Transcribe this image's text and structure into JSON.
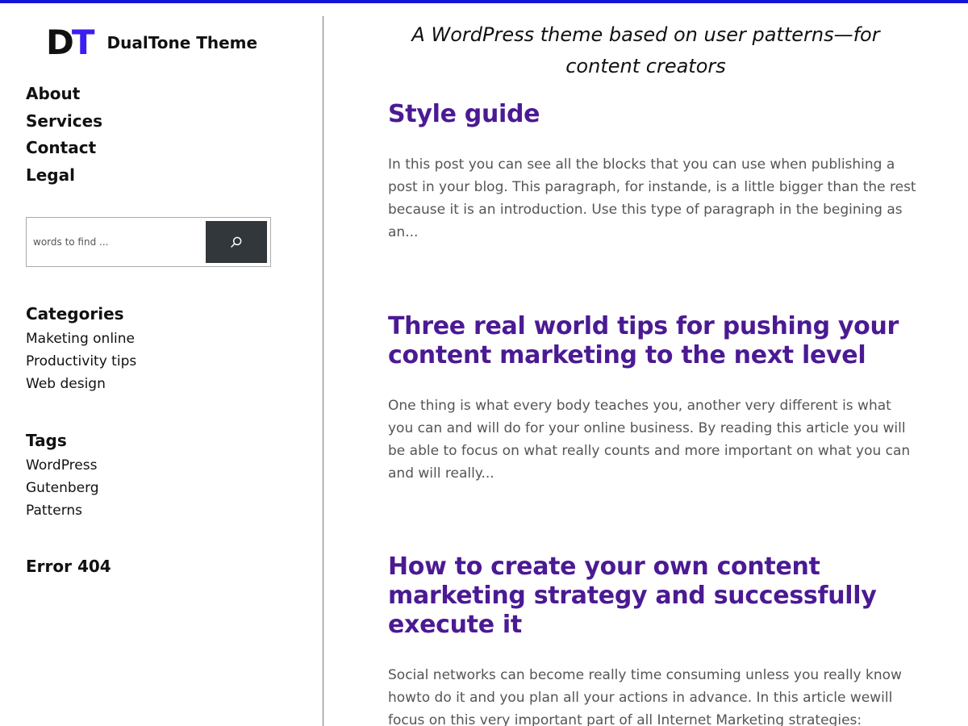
{
  "site": {
    "logo_letter_1": "D",
    "logo_letter_2": "T",
    "title": "DualTone Theme",
    "tagline": "A WordPress theme based on user patterns—for content creators",
    "accent_color": "#3c1ef0",
    "heading_color": "#4b1a93",
    "topbar_color": "#1414d6"
  },
  "nav": [
    "About",
    "Services",
    "Contact",
    "Legal"
  ],
  "search": {
    "placeholder": "words to find ...",
    "value": "",
    "button_icon": "search-icon"
  },
  "categories": {
    "title": "Categories",
    "items": [
      "Maketing online",
      "Productivity tips",
      "Web design"
    ]
  },
  "tags": {
    "title": "Tags",
    "items": [
      "WordPress",
      "Gutenberg",
      "Patterns"
    ]
  },
  "error_link": "Error 404",
  "posts": [
    {
      "title": "Style guide",
      "excerpt": "In this post you can see all the blocks that you can use when publishing a post in your blog. This paragraph, for instande, is a little bigger than the rest because it is an introduction. Use this type of paragraph in the begining as an..."
    },
    {
      "title": "Three real world tips for pushing your content marketing to the next level",
      "excerpt": "One thing is what every body teaches you, another very different is what you can and will do for your online business. By reading this article you will be able to focus on what really counts and more important on what you can and will really..."
    },
    {
      "title": "How to create your own content marketing strategy and successfully execute it",
      "excerpt": "Social networks can become really time consuming unless you really know howto do it and you plan all your actions in advance. In this article wewill focus on this very important part of all Internet Marketing strategies: planning your editorial calendar and execute in the most..."
    }
  ]
}
